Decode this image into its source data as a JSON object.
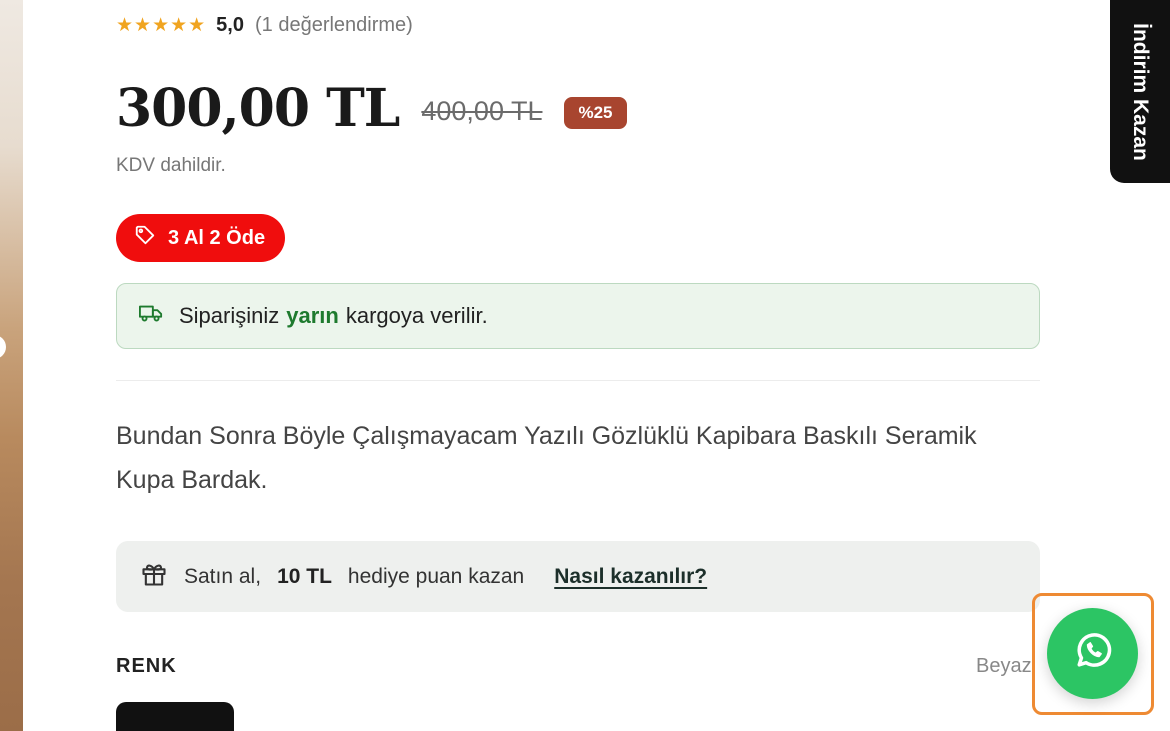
{
  "rating": {
    "stars": "★★★★★",
    "score": "5,0",
    "count_text": "(1 değerlendirme)"
  },
  "price": {
    "current": "300,00 TL",
    "old": "400,00 TL",
    "discount": "%25",
    "vat_note": "KDV dahildir."
  },
  "promo": {
    "label": "3 Al 2 Öde"
  },
  "shipping": {
    "before": "Siparişiniz",
    "highlight": "yarın",
    "after": "kargoya verilir."
  },
  "description": "Bundan Sonra Böyle Çalışmayacam Yazılı Gözlüklü Kapibara Baskılı Seramik Kupa Bardak.",
  "points": {
    "prefix": "Satın al,",
    "amount": "10 TL",
    "suffix": "hediye puan kazan",
    "link": "Nasıl kazanılır?"
  },
  "color": {
    "label": "RENK",
    "value": "Beyaz"
  },
  "side_tab": {
    "label": "İndirim Kazan"
  },
  "colors": {
    "star": "#f0a420",
    "discount_badge": "#a8452f",
    "promo": "#f00d0d",
    "shipping_green": "#1e7a2e",
    "whatsapp": "#2cc564",
    "highlight_frame": "#ee8a33"
  },
  "icons": {
    "promo": "tag-icon",
    "shipping": "truck-icon",
    "points": "gift-icon",
    "chat": "whatsapp-icon"
  }
}
